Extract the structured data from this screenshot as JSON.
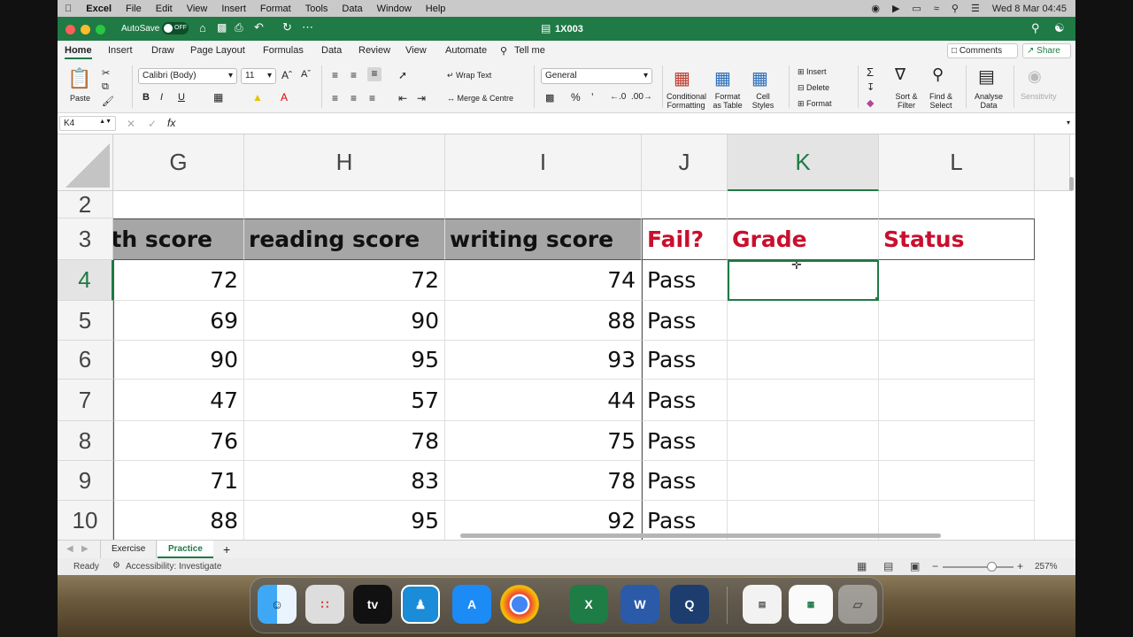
{
  "menubar": {
    "app": "Excel",
    "items": [
      "File",
      "Edit",
      "View",
      "Insert",
      "Format",
      "Tools",
      "Data",
      "Window",
      "Help"
    ],
    "datetime": "Wed 8 Mar  04:45"
  },
  "titlebar": {
    "autosave_label": "AutoSave",
    "autosave_state": "OFF",
    "doc_title": "1X003"
  },
  "tabs": [
    "Home",
    "Insert",
    "Draw",
    "Page Layout",
    "Formulas",
    "Data",
    "Review",
    "View",
    "Automate"
  ],
  "tell_me": "Tell me",
  "comments": "Comments",
  "share": "Share",
  "ribbon": {
    "paste": "Paste",
    "font": "Calibri (Body)",
    "size": "11",
    "wrap": "Wrap Text",
    "merge": "Merge & Centre",
    "number_format": "General",
    "cond": "Conditional",
    "cond2": "Formatting",
    "fmt_table": "Format",
    "fmt_table2": "as Table",
    "cell_styles": "Cell",
    "cell_styles2": "Styles",
    "insert": "Insert",
    "delete": "Delete",
    "format": "Format",
    "sort": "Sort &",
    "sort2": "Filter",
    "find": "Find &",
    "find2": "Select",
    "analyse": "Analyse",
    "analyse2": "Data",
    "sensitivity": "Sensitivity"
  },
  "formula": {
    "name_box": "K4",
    "fx": "fx"
  },
  "columns": [
    "G",
    "H",
    "I",
    "J",
    "K",
    "L"
  ],
  "rows": [
    "2",
    "3",
    "4",
    "5",
    "6",
    "7",
    "8",
    "9",
    "10"
  ],
  "headers": {
    "g": "ath score",
    "h": "reading score",
    "i": "writing score",
    "j": "Fail?",
    "k": "Grade",
    "l": "Status"
  },
  "data": [
    {
      "g": "72",
      "h": "72",
      "i": "74",
      "j": "Pass"
    },
    {
      "g": "69",
      "h": "90",
      "i": "88",
      "j": "Pass"
    },
    {
      "g": "90",
      "h": "95",
      "i": "93",
      "j": "Pass"
    },
    {
      "g": "47",
      "h": "57",
      "i": "44",
      "j": "Pass"
    },
    {
      "g": "76",
      "h": "78",
      "i": "75",
      "j": "Pass"
    },
    {
      "g": "71",
      "h": "83",
      "i": "78",
      "j": "Pass"
    },
    {
      "g": "88",
      "h": "95",
      "i": "92",
      "j": "Pass"
    }
  ],
  "sheets": [
    "Exercise",
    "Practice"
  ],
  "status": {
    "ready": "Ready",
    "accessibility": "Accessibility: Investigate",
    "zoom": "257%"
  },
  "dock": [
    {
      "name": "finder-icon"
    },
    {
      "name": "launchpad-icon"
    },
    {
      "name": "apple-tv-icon",
      "label": "tv"
    },
    {
      "name": "kindle-icon"
    },
    {
      "name": "app-store-icon"
    },
    {
      "name": "chrome-icon"
    },
    {
      "name": "excel-icon",
      "label": "X"
    },
    {
      "name": "word-icon",
      "label": "W"
    },
    {
      "name": "quicktime-icon"
    }
  ]
}
